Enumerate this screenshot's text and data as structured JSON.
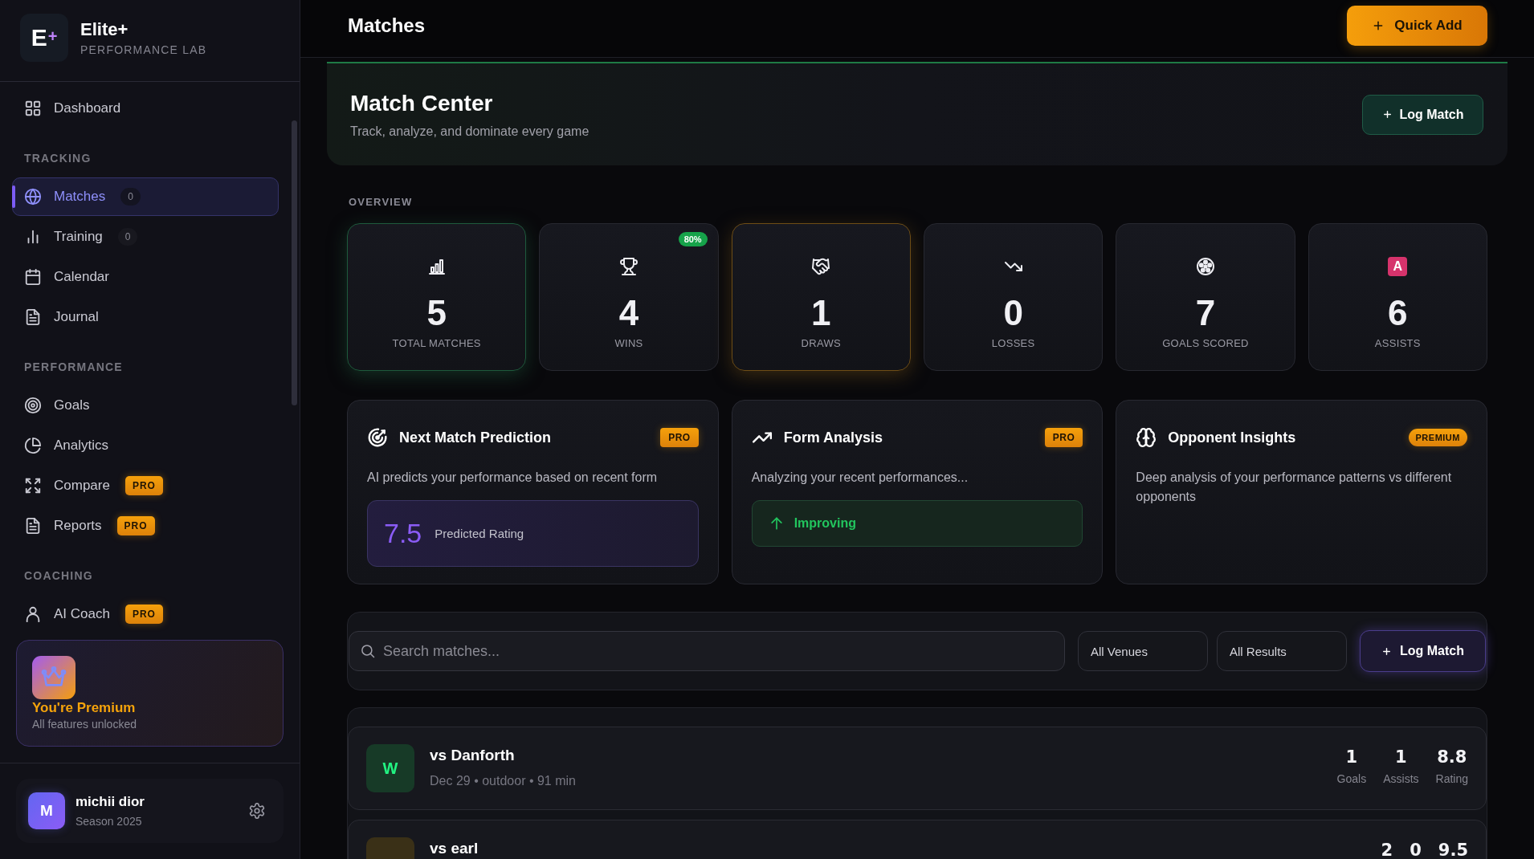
{
  "sidebar": {
    "brand": {
      "logo_letter": "E",
      "logo_mark": "+",
      "name": "Elite+",
      "tagline": "PERFORMANCE LAB"
    },
    "nav": [
      {
        "label": "Dashboard",
        "selected": false
      }
    ],
    "sections": [
      {
        "title": "TRACKING",
        "items": [
          {
            "label": "Matches",
            "count": "0",
            "selected": true
          },
          {
            "label": "Training",
            "count": "0",
            "selected": false
          },
          {
            "label": "Calendar",
            "selected": false
          },
          {
            "label": "Journal",
            "selected": false
          }
        ]
      },
      {
        "title": "PERFORMANCE",
        "items": [
          {
            "label": "Goals",
            "selected": false
          },
          {
            "label": "Analytics",
            "selected": false
          },
          {
            "label": "Compare",
            "badge": "PRO",
            "selected": false
          },
          {
            "label": "Reports",
            "badge": "PRO",
            "selected": false
          }
        ]
      },
      {
        "title": "COACHING",
        "items": [
          {
            "label": "AI Coach",
            "badge": "PRO",
            "selected": false
          }
        ]
      }
    ],
    "premium": {
      "title": "You're Premium",
      "subtitle": "All features unlocked"
    },
    "user": {
      "initial": "M",
      "name": "michii dior",
      "subtitle": "Season 2025"
    }
  },
  "header": {
    "title": "Matches",
    "button": "Quick Add"
  },
  "match_center": {
    "title": "Match Center",
    "subtitle": "Track, analyze, and dominate every game",
    "button": "Log Match"
  },
  "overview": {
    "label": "OVERVIEW",
    "stats": [
      {
        "value": "5",
        "label": "TOTAL MATCHES",
        "color": "#1e5a3c"
      },
      {
        "value": "4",
        "label": "WINS",
        "badge": "80%"
      },
      {
        "value": "1",
        "label": "DRAWS",
        "color": "#6e4d15"
      },
      {
        "value": "0",
        "label": "LOSSES"
      },
      {
        "value": "7",
        "label": "GOALS SCORED"
      },
      {
        "value": "6",
        "label": "ASSISTS",
        "icon_text": "A"
      }
    ]
  },
  "insights": [
    {
      "kind": "prediction",
      "title": "Next Match Prediction",
      "badge": {
        "label": "PRO",
        "kind": "tag"
      },
      "description": "AI predicts your performance based on recent form",
      "value": "7.5",
      "value_label": "Predicted Rating"
    },
    {
      "kind": "trend",
      "title": "Form Analysis",
      "badge": {
        "label": "PRO",
        "kind": "tag"
      },
      "description": "Analyzing your recent performances...",
      "trend": "Improving"
    },
    {
      "kind": "text",
      "title": "Opponent Insights",
      "badge": {
        "label": "PREMIUM",
        "kind": "pill"
      },
      "description": "Deep analysis of your performance patterns vs different opponents"
    }
  ],
  "filters": {
    "placeholder": "Search matches...",
    "dropdowns": [
      "All Venues",
      "All Results"
    ],
    "button": "Log Match"
  },
  "matches": [
    {
      "result": "W",
      "color": "#173a27",
      "title": "vs Danforth",
      "meta": "Dec 29 • outdoor • 91 min",
      "stats": [
        {
          "value": "1",
          "label": "Goals"
        },
        {
          "value": "1",
          "label": "Assists"
        },
        {
          "value": "8.8",
          "label": "Rating"
        }
      ]
    },
    {
      "color": "#3a3017",
      "title": "vs earl",
      "stats": [
        {
          "value": "2"
        },
        {
          "value": "0"
        },
        {
          "value": "9.5"
        }
      ]
    }
  ]
}
